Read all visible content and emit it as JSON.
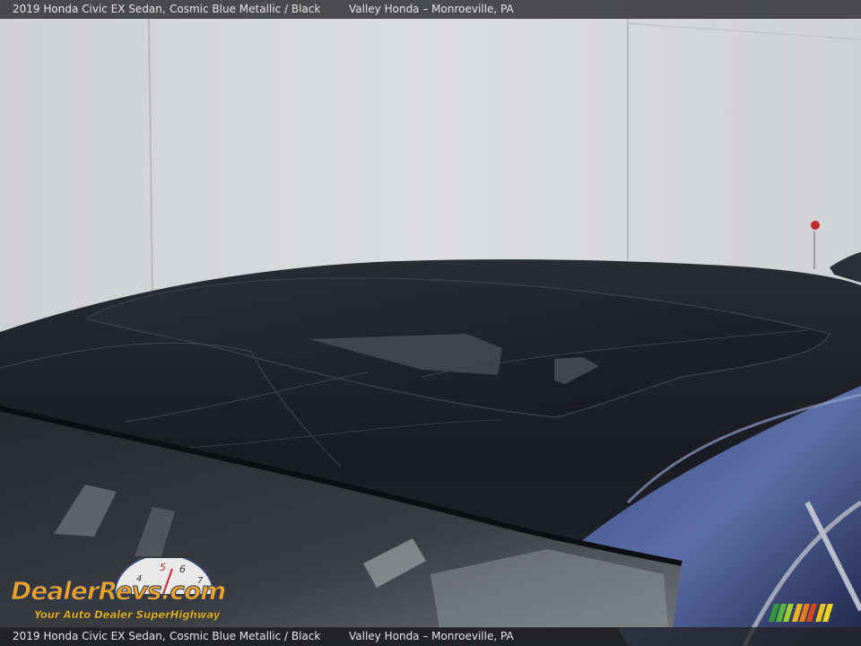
{
  "caption": {
    "model": "2019 Honda Civic EX Sedan,",
    "color": "Cosmic Blue Metallic / Black",
    "dealer": "Valley Honda – Monroeville, PA"
  },
  "watermark": {
    "brand": "DealerRevs.com",
    "tagline": "Your Auto Dealer SuperHighway"
  },
  "colors": {
    "wall": "#d4d5d7",
    "roof": "#1b1d24",
    "body_blue": "#2a3560",
    "caption_bar": "#222226"
  }
}
